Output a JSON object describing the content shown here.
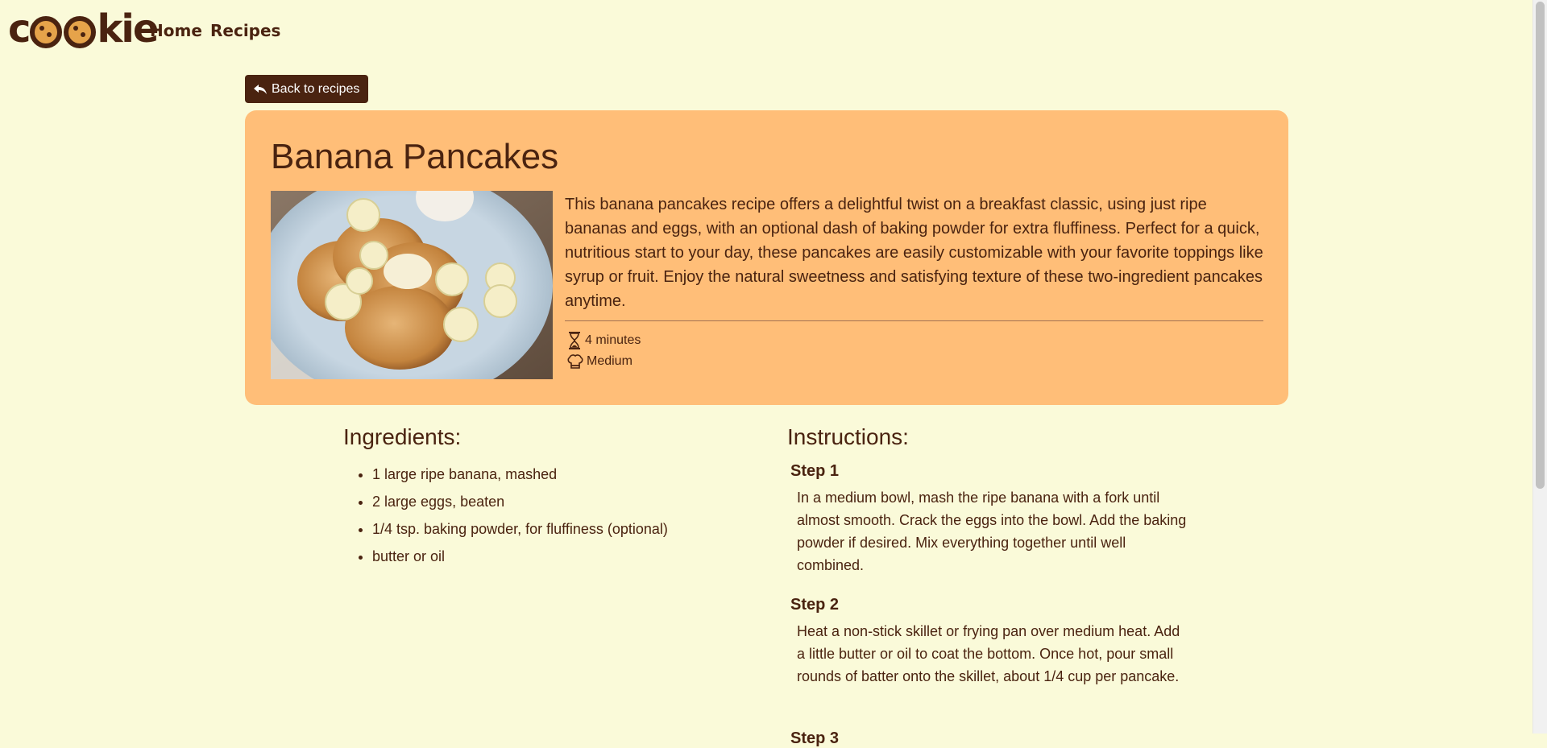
{
  "nav": {
    "logo": "cookie",
    "links": [
      "Home",
      "Recipes"
    ]
  },
  "back_button": {
    "label": "Back to recipes",
    "icon": "reply-arrow-icon"
  },
  "recipe": {
    "title": "Banana Pancakes",
    "description": "This banana pancakes recipe offers a delightful twist on a breakfast classic, using just ripe bananas and eggs, with an optional dash of baking powder for extra fluffiness. Perfect for a quick, nutritious start to your day, these pancakes are easily customizable with your favorite toppings like syrup or fruit. Enjoy the natural sweetness and satisfying texture of these two-ingredient pancakes anytime.",
    "time": "4 minutes",
    "difficulty": "Medium",
    "time_icon": "hourglass-icon",
    "difficulty_icon": "chef-hat-icon"
  },
  "ingredients": {
    "heading": "Ingredients:",
    "items": [
      "1 large ripe banana, mashed",
      "2 large eggs, beaten",
      "1/4 tsp. baking powder, for fluffiness (optional)",
      "butter or oil"
    ]
  },
  "instructions": {
    "heading": "Instructions:",
    "steps": [
      {
        "title": "Step 1",
        "text": "In a medium bowl, mash the ripe banana with a fork until almost smooth. Crack the eggs into the bowl. Add the baking powder if desired. Mix everything together until well combined."
      },
      {
        "title": "Step 2",
        "text": "Heat a non-stick skillet or frying pan over medium heat. Add a little butter or oil to coat the bottom. Once hot, pour small rounds of batter onto the skillet, about 1/4 cup per pancake."
      },
      {
        "title": "Step 3"
      }
    ]
  },
  "colors": {
    "background": "#fafad9",
    "brand_dark": "#4a2310",
    "card": "#ffbe78"
  }
}
